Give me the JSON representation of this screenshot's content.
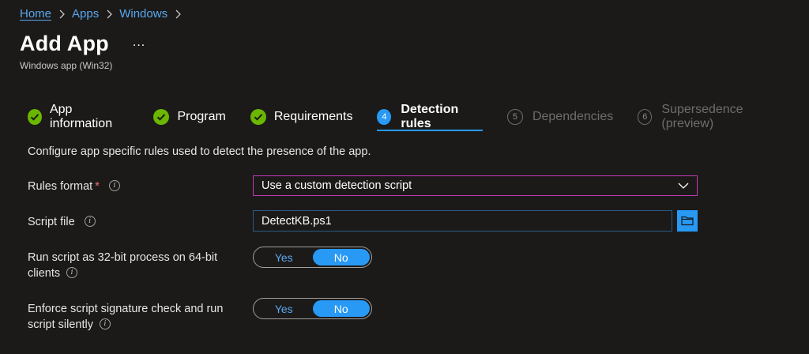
{
  "breadcrumb": {
    "items": [
      "Home",
      "Apps",
      "Windows"
    ]
  },
  "header": {
    "title": "Add App",
    "more": "...",
    "subtitle": "Windows app (Win32)"
  },
  "steps": [
    {
      "number": "",
      "label": "App information",
      "state": "done"
    },
    {
      "number": "",
      "label": "Program",
      "state": "done"
    },
    {
      "number": "",
      "label": "Requirements",
      "state": "done"
    },
    {
      "number": "4",
      "label": "Detection rules",
      "state": "current"
    },
    {
      "number": "5",
      "label": "Dependencies",
      "state": "future"
    },
    {
      "number": "6",
      "label": "Supersedence (preview)",
      "state": "future"
    }
  ],
  "form": {
    "description": "Configure app specific rules used to detect the presence of the app.",
    "rules_format": {
      "label": "Rules format",
      "required_mark": "*",
      "value": "Use a custom detection script"
    },
    "script_file": {
      "label": "Script file",
      "value": "DetectKB.ps1"
    },
    "run_32bit": {
      "label_line1": "Run script as 32-bit process on 64-bit",
      "label_line2": "clients",
      "yes": "Yes",
      "no": "No",
      "selected": "No"
    },
    "enforce_signature": {
      "label_line1": "Enforce script signature check and run",
      "label_line2": "script silently",
      "yes": "Yes",
      "no": "No",
      "selected": "No"
    }
  },
  "colors": {
    "background": "#1b1a19",
    "accent": "#2899f5",
    "success": "#6bb700",
    "focus_border": "#c239b3"
  },
  "icons": {
    "done": "checkmark-circle-icon",
    "dropdown": "chevron-down-icon",
    "browse": "folder-icon",
    "info": "info-icon"
  }
}
